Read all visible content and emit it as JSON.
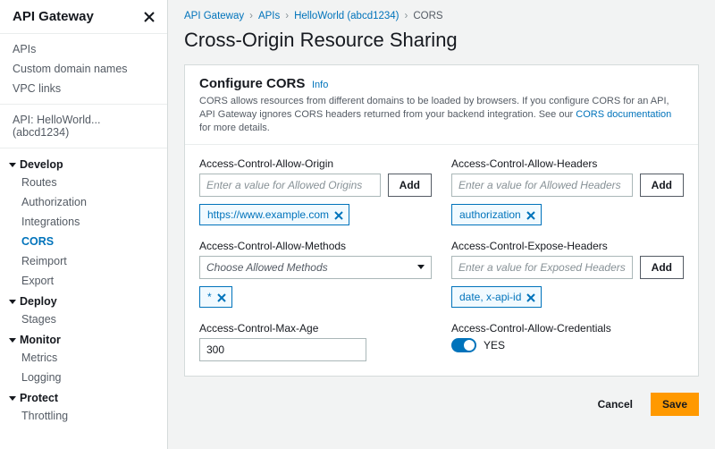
{
  "sidebar": {
    "title": "API Gateway",
    "nav": {
      "top": [
        {
          "label": "APIs"
        },
        {
          "label": "Custom domain names"
        },
        {
          "label": "VPC links"
        }
      ],
      "api_scope": "API: HelloWorld...(abcd1234)",
      "sections": [
        {
          "title": "Develop",
          "items": [
            {
              "label": "Routes"
            },
            {
              "label": "Authorization"
            },
            {
              "label": "Integrations"
            },
            {
              "label": "CORS",
              "active": true
            },
            {
              "label": "Reimport"
            },
            {
              "label": "Export"
            }
          ]
        },
        {
          "title": "Deploy",
          "items": [
            {
              "label": "Stages"
            }
          ]
        },
        {
          "title": "Monitor",
          "items": [
            {
              "label": "Metrics"
            },
            {
              "label": "Logging"
            }
          ]
        },
        {
          "title": "Protect",
          "items": [
            {
              "label": "Throttling"
            }
          ]
        }
      ]
    }
  },
  "breadcrumbs": [
    {
      "label": "API Gateway"
    },
    {
      "label": "APIs"
    },
    {
      "label": "HelloWorld (abcd1234)"
    },
    {
      "label": "CORS",
      "current": true
    }
  ],
  "page_title": "Cross-Origin Resource Sharing",
  "panel": {
    "title": "Configure CORS",
    "info_label": "Info",
    "desc_prefix": "CORS allows resources from different domains to be loaded by browsers. If you configure CORS for an API, API Gateway ignores CORS headers returned from your backend integration. See our ",
    "desc_link": "CORS documentation",
    "desc_suffix": " for more details.",
    "add_label": "Add",
    "fields": {
      "allow_origin": {
        "label": "Access-Control-Allow-Origin",
        "placeholder": "Enter a value for Allowed Origins",
        "tokens": [
          "https://www.example.com"
        ]
      },
      "allow_headers": {
        "label": "Access-Control-Allow-Headers",
        "placeholder": "Enter a value for Allowed Headers",
        "tokens": [
          "authorization"
        ]
      },
      "allow_methods": {
        "label": "Access-Control-Allow-Methods",
        "placeholder": "Choose Allowed Methods",
        "tokens": [
          "*"
        ]
      },
      "expose_headers": {
        "label": "Access-Control-Expose-Headers",
        "placeholder": "Enter a value for Exposed Headers",
        "tokens": [
          "date, x-api-id"
        ]
      },
      "max_age": {
        "label": "Access-Control-Max-Age",
        "value": "300"
      },
      "allow_credentials": {
        "label": "Access-Control-Allow-Credentials",
        "value": "YES"
      }
    }
  },
  "actions": {
    "cancel": "Cancel",
    "save": "Save"
  }
}
